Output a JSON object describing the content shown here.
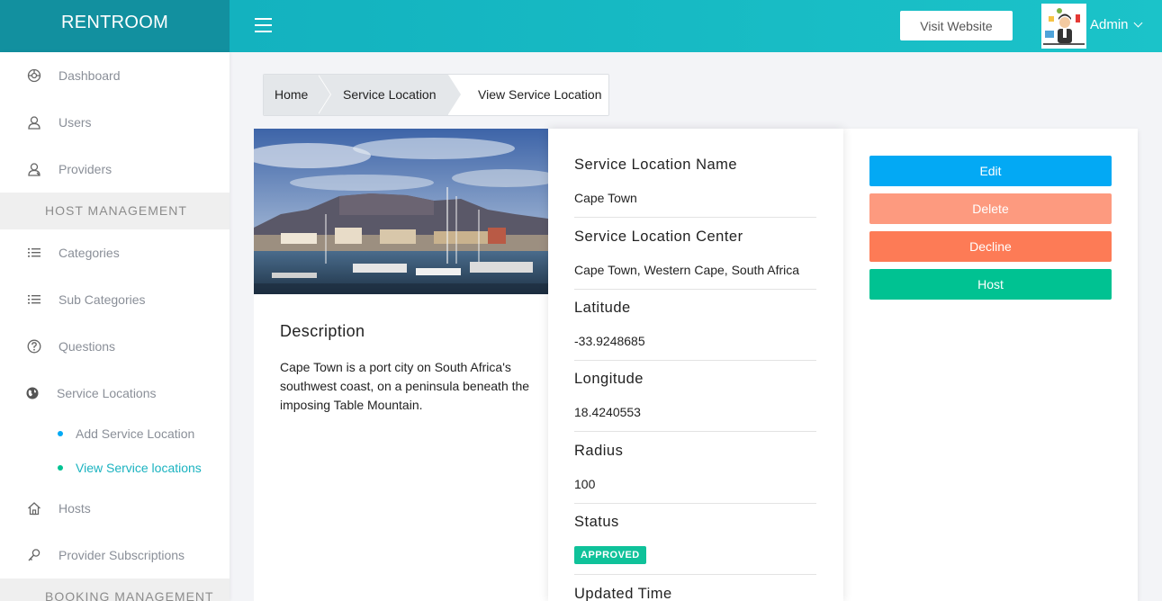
{
  "app": {
    "brand": "RENTROOM"
  },
  "header": {
    "visit_label": "Visit Website",
    "admin_label": "Admin"
  },
  "sidebar": {
    "items": [
      {
        "label": "Dashboard",
        "icon": "dashboard-icon"
      },
      {
        "label": "Users",
        "icon": "user-icon"
      },
      {
        "label": "Providers",
        "icon": "providers-icon"
      }
    ],
    "section_host": "HOST MANAGEMENT",
    "host_items": [
      {
        "label": "Categories",
        "icon": "list-icon"
      },
      {
        "label": "Sub Categories",
        "icon": "list-icon"
      },
      {
        "label": "Questions",
        "icon": "question-icon"
      },
      {
        "label": "Service Locations",
        "icon": "globe-icon"
      }
    ],
    "sub_items": [
      {
        "label": "Add Service Location",
        "active": false
      },
      {
        "label": "View Service locations",
        "active": true
      }
    ],
    "more_items": [
      {
        "label": "Hosts",
        "icon": "home-icon"
      },
      {
        "label": "Provider Subscriptions",
        "icon": "key-icon"
      }
    ],
    "section_booking": "BOOKING MANAGEMENT"
  },
  "breadcrumb": [
    "Home",
    "Service Location",
    "View Service Location"
  ],
  "location": {
    "description_title": "Description",
    "description": "Cape Town is a port city on South Africa's southwest coast, on a peninsula beneath the imposing Table Mountain.",
    "fields": [
      {
        "label": "Service Location Name",
        "value": "Cape Town"
      },
      {
        "label": "Service Location Center",
        "value": "Cape Town, Western Cape, South Africa"
      },
      {
        "label": "Latitude",
        "value": "-33.9248685"
      },
      {
        "label": "Longitude",
        "value": "18.4240553"
      },
      {
        "label": "Radius",
        "value": "100"
      }
    ],
    "status_label": "Status",
    "status_value": "APPROVED",
    "updated_label": "Updated Time"
  },
  "actions": {
    "edit": "Edit",
    "delete": "Delete",
    "decline": "Decline",
    "host": "Host"
  },
  "colors": {
    "topbar": "#1bbcc6",
    "brand_bg": "#12909f",
    "edit": "#03a9f4",
    "delete": "#fd9a7f",
    "decline": "#fd7b56",
    "host": "#00c292",
    "approved": "#0fc29a",
    "active_link": "#1bb3c0"
  }
}
